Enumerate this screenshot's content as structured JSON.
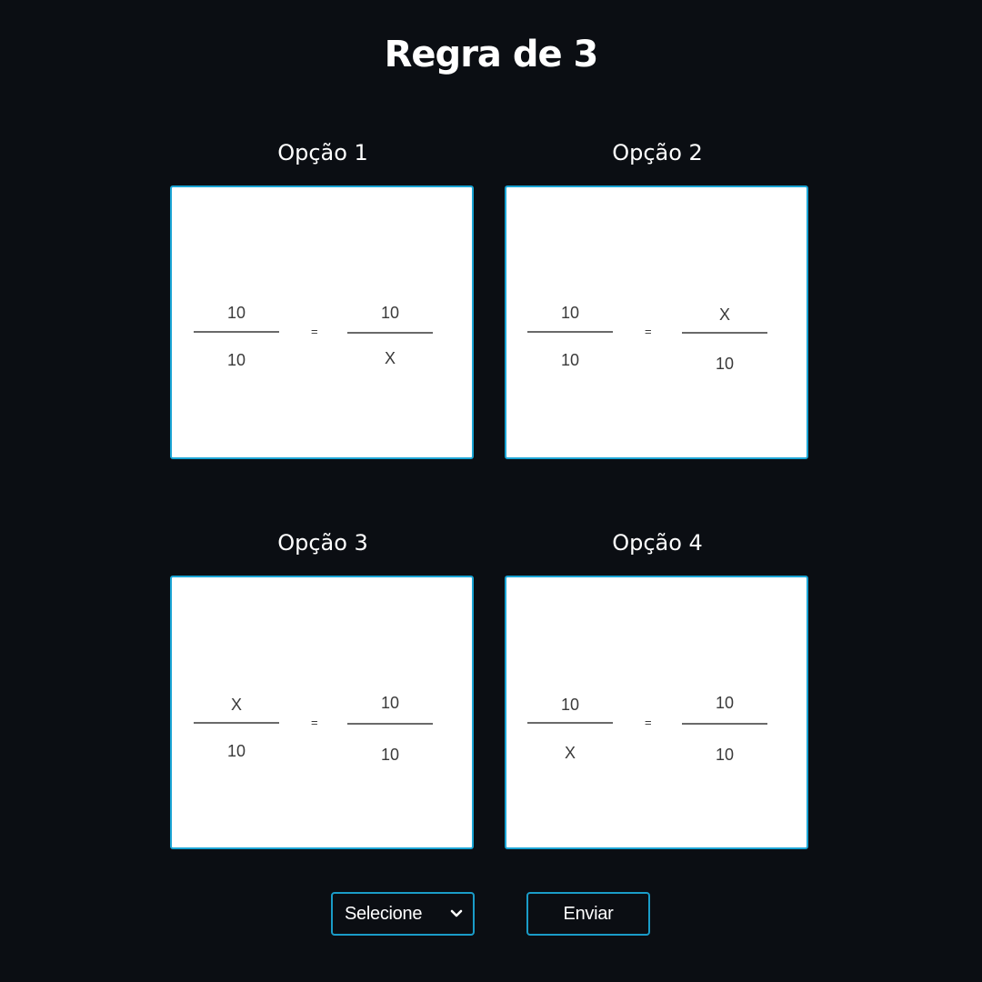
{
  "title": "Regra de 3",
  "accent_color": "#1aa4d4",
  "options": [
    {
      "label": "Opção 1",
      "left": {
        "top": "10",
        "bottom": "10"
      },
      "equals": "=",
      "right": {
        "top": "10",
        "bottom": "X"
      }
    },
    {
      "label": "Opção 2",
      "left": {
        "top": "10",
        "bottom": "10"
      },
      "equals": "=",
      "right": {
        "top": "X",
        "bottom": "10"
      }
    },
    {
      "label": "Opção 3",
      "left": {
        "top": "X",
        "bottom": "10"
      },
      "equals": "=",
      "right": {
        "top": "10",
        "bottom": "10"
      }
    },
    {
      "label": "Opção 4",
      "left": {
        "top": "10",
        "bottom": "X"
      },
      "equals": "=",
      "right": {
        "top": "10",
        "bottom": "10"
      }
    }
  ],
  "controls": {
    "select": {
      "value": "Selecione",
      "icon": "chevron-down-icon"
    },
    "submit_label": "Enviar"
  }
}
